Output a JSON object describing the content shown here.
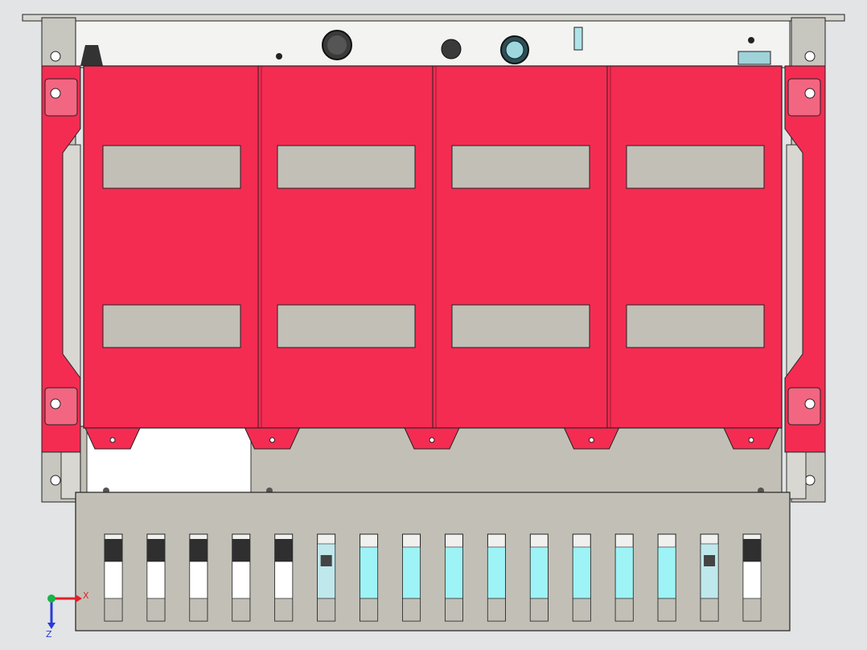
{
  "viewport": {
    "background_color": "#e2e4e6"
  },
  "model": {
    "cover_color": "#f42c52",
    "metal_color": "#c2c0b6",
    "panel_light_color": "#f0f0ee",
    "window_color": "#c2c0b6",
    "cover_sections": 4,
    "slot_count": 16,
    "slot_states": [
      "dark",
      "dark",
      "dark",
      "dark",
      "dark",
      "component",
      "cyan",
      "cyan",
      "cyan",
      "cyan",
      "cyan",
      "cyan",
      "cyan",
      "cyan",
      "component",
      "dark"
    ]
  },
  "triad": {
    "x_label": "X",
    "z_label": "Z",
    "x_color": "#e0202a",
    "y_color": "#19b34a",
    "z_color": "#2a3ad8"
  }
}
